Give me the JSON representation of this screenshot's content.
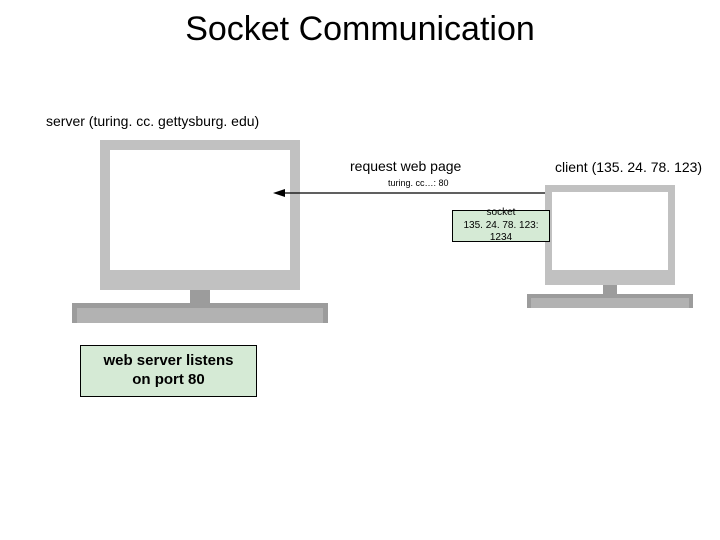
{
  "title": "Socket Communication",
  "server": {
    "label": "server (turing. cc. gettysburg. edu)"
  },
  "client": {
    "label": "client (135. 24. 78. 123)"
  },
  "request": {
    "label": "request web page",
    "sub": "turing. cc…: 80"
  },
  "socket_box": {
    "line1": "socket",
    "line2": "135. 24. 78. 123: 1234"
  },
  "listen_box": {
    "line1": "web server listens",
    "line2": "on port 80"
  }
}
